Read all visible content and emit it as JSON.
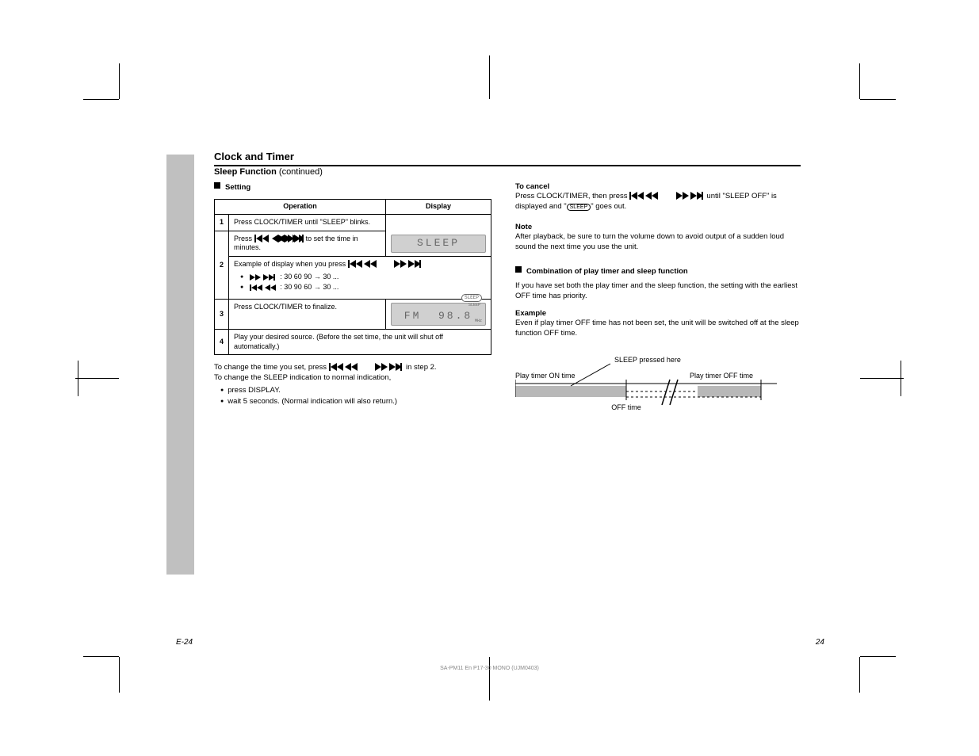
{
  "header": {
    "title": "Clock and Timer",
    "subtitle_prefix": "Sleep Function ",
    "subtitle_cont": "(continued)"
  },
  "left": {
    "section_title": "Setting",
    "table": {
      "col_operation": "Operation",
      "col_display": "Display",
      "row1_op": "Press CLOCK/TIMER until \"SLEEP\" blinks.",
      "row2_op_before": "Press ",
      "row2_op_after": " to set the time in minutes.",
      "row2_ex_prefix": "Example of display when you press ",
      "row2_ex1_a": " 30  60  90 ",
      "row2_ex1_b": " 30 ...",
      "row2_ex2_a": " 30  90  60 ",
      "row2_ex2_b": "  30 ...",
      "row3_op": "Press CLOCK/TIMER to finalize.",
      "row4_op": "Play your desired source. (Before the set time, the unit will shut off automatically.)",
      "lcd1": "SLEEP",
      "lcd2_left": "FM",
      "lcd2_right": "98.8",
      "lcd2_badge": "SLEEP",
      "lcd2_tiny1": "SLEEP",
      "lcd2_tiny2": "MHz"
    },
    "under_line1_a": "To change the time you set, press ",
    "under_line1_b": " in step 2.",
    "under_line2": "To change the SLEEP indication to normal indication,",
    "under_bullets": [
      "press DISPLAY.",
      "wait 5 seconds. (Normal indication will also return.)"
    ]
  },
  "right": {
    "cancel_title": "To cancel",
    "cancel_text_a": "Press CLOCK/TIMER, then press ",
    "cancel_text_b": " until \"SLEEP OFF\" is displayed and \"",
    "cancel_text_c": "\" goes out.",
    "sleep_badge": "SLEEP",
    "note_label": "Note",
    "note_text": "After playback, be sure to turn the volume down to avoid output of a sudden loud sound the next time you use the unit.",
    "combo_title": "Combination of play timer and sleep function",
    "combo_text": "If you have set both the play timer and the sleep function, the setting with the earliest OFF time has priority.",
    "ex_label": "Example",
    "ex_text": "Even if play timer OFF time has not been set, the unit will be switched off at the sleep function OFF time.",
    "diag": {
      "play_on": "Play timer ON time",
      "play_off": "Play timer OFF time",
      "sleep_pressed": "SLEEP pressed here",
      "off_time": "OFF time"
    }
  },
  "footer": {
    "page_left": "E-24",
    "page_right": "24",
    "imprint": "SA-PM11 En  P17-30  MONO  (UJM0403)"
  }
}
